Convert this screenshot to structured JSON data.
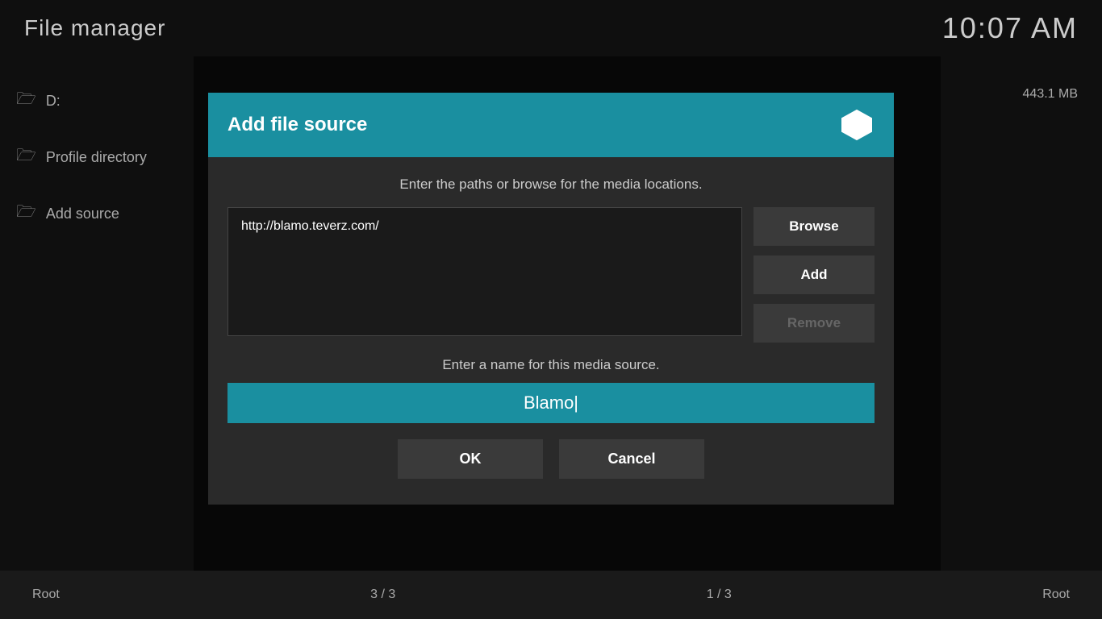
{
  "header": {
    "app_title": "File manager",
    "clock": "10:07 AM"
  },
  "sidebar": {
    "items": [
      {
        "id": "d-drive",
        "label": "D:",
        "icon": "folder-icon"
      },
      {
        "id": "profile-directory",
        "label": "Profile directory",
        "icon": "folder-icon"
      },
      {
        "id": "add-source",
        "label": "Add source",
        "icon": "folder-icon"
      }
    ]
  },
  "right_panel": {
    "file_size": "443.1 MB"
  },
  "footer": {
    "left_label": "Root",
    "left_pagination": "3 / 3",
    "right_pagination": "1 / 3",
    "right_label": "Root"
  },
  "dialog": {
    "title": "Add file source",
    "instruction_paths": "Enter the paths or browse for the media locations.",
    "path_value": "http://blamo.teverz.com/",
    "buttons": {
      "browse": "Browse",
      "add": "Add",
      "remove": "Remove"
    },
    "instruction_name": "Enter a name for this media source.",
    "name_value": "Blamo|",
    "ok_label": "OK",
    "cancel_label": "Cancel"
  }
}
